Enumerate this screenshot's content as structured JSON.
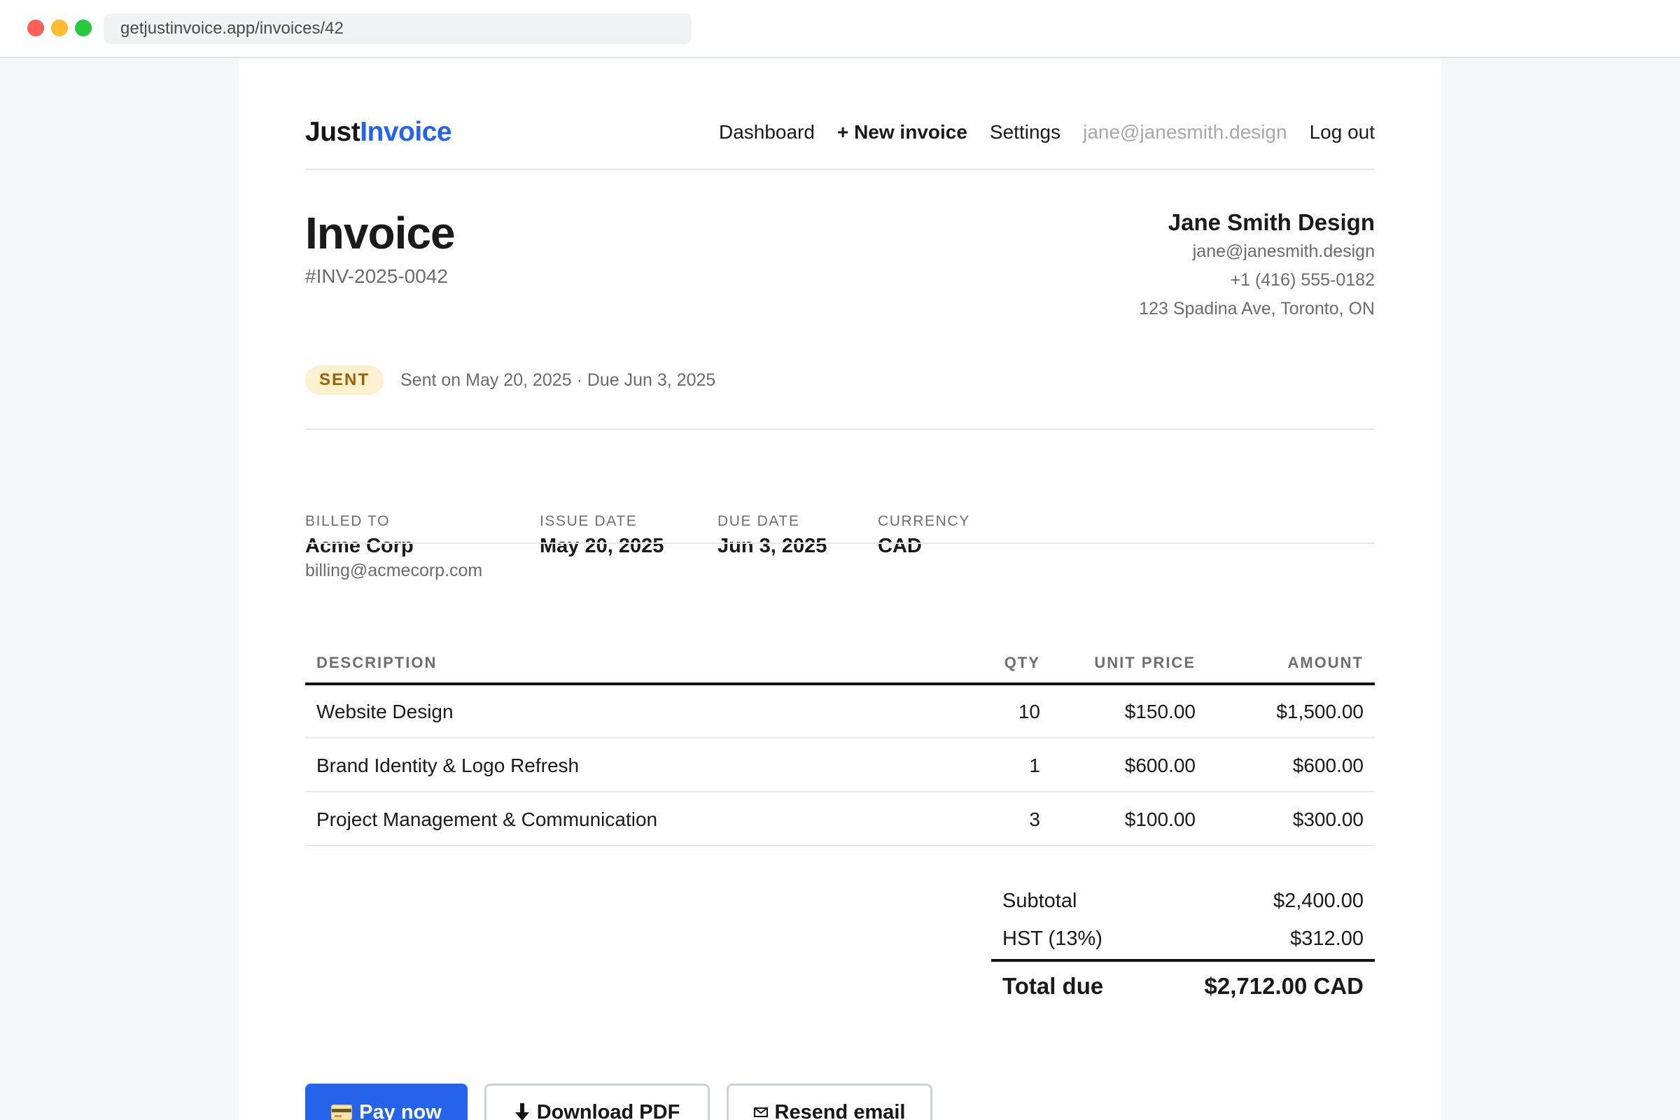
{
  "browser": {
    "url": "getjustinvoice.app/invoices/42"
  },
  "nav": {
    "logo_part1": "Just",
    "logo_part2": "Invoice",
    "links": {
      "dashboard": "Dashboard",
      "new_invoice": "+ New invoice",
      "settings": "Settings",
      "user_email": "jane@janesmith.design",
      "logout": "Log out"
    }
  },
  "invoice": {
    "title": "Invoice",
    "number": "#INV-2025-0042",
    "status": "SENT",
    "status_text": "Sent on May 20, 2025 · Due Jun 3, 2025"
  },
  "from": {
    "name": "Jane Smith Design",
    "email": "jane@janesmith.design",
    "phone": "+1 (416) 555-0182",
    "address": "123 Spadina Ave, Toronto, ON"
  },
  "meta": {
    "billed_to_label": "BILLED TO",
    "billed_to_name": "Acme Corp",
    "billed_to_email": "billing@acmecorp.com",
    "issue_date_label": "ISSUE DATE",
    "issue_date": "May 20, 2025",
    "due_date_label": "DUE DATE",
    "due_date": "Jun 3, 2025",
    "currency_label": "CURRENCY",
    "currency": "CAD"
  },
  "table": {
    "headers": {
      "description": "DESCRIPTION",
      "qty": "QTY",
      "unit_price": "UNIT PRICE",
      "amount": "AMOUNT"
    },
    "rows": [
      {
        "description": "Website Design",
        "qty": "10",
        "unit_price": "$150.00",
        "amount": "$1,500.00"
      },
      {
        "description": "Brand Identity & Logo Refresh",
        "qty": "1",
        "unit_price": "$600.00",
        "amount": "$600.00"
      },
      {
        "description": "Project Management & Communication",
        "qty": "3",
        "unit_price": "$100.00",
        "amount": "$300.00"
      }
    ]
  },
  "totals": {
    "subtotal_label": "Subtotal",
    "subtotal": "$2,400.00",
    "tax_label": "HST (13%)",
    "tax": "$312.00",
    "total_label": "Total due",
    "total": "$2,712.00 CAD"
  },
  "actions": {
    "pay_now": "Pay now",
    "pay_now_icon": "credit-card-icon",
    "download_pdf": "Download PDF",
    "download_icon": "download-arrow-icon",
    "resend_email": "Resend email",
    "resend_icon": "envelope-icon"
  },
  "colors": {
    "accent": "#2563eb",
    "badge_bg": "#fdf0cf",
    "badge_text": "#9a6105"
  }
}
